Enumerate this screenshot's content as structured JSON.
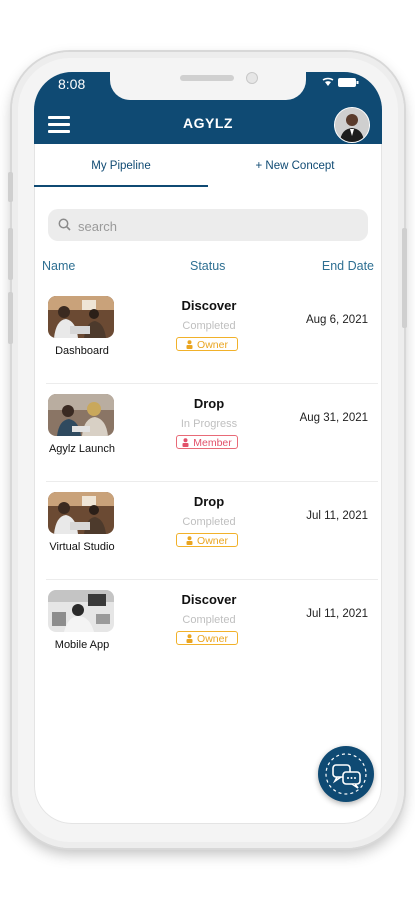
{
  "status_bar": {
    "time": "8:08",
    "icons": "wifi-icon battery-icon"
  },
  "app_bar": {
    "title": "AGYLZ"
  },
  "tabs": [
    {
      "label": "My Pipeline",
      "active": true
    },
    {
      "label": "+ New Concept",
      "active": false
    }
  ],
  "search": {
    "placeholder": "search",
    "value": ""
  },
  "columns": {
    "name": "Name",
    "status": "Status",
    "end_date": "End Date"
  },
  "rows": [
    {
      "name": "Dashboard",
      "stage": "Discover",
      "progress": "Completed",
      "role": "Owner",
      "end_date": "Aug 6, 2021"
    },
    {
      "name": "Agylz Launch",
      "stage": "Drop",
      "progress": "In Progress",
      "role": "Member",
      "end_date": "Aug 31, 2021"
    },
    {
      "name": "Virtual Studio",
      "stage": "Drop",
      "progress": "Completed",
      "role": "Owner",
      "end_date": "Jul 11, 2021"
    },
    {
      "name": "Mobile App",
      "stage": "Discover",
      "progress": "Completed",
      "role": "Owner",
      "end_date": "Jul 11, 2021"
    }
  ],
  "colors": {
    "primary": "#0f4a73",
    "owner": "#eaa520",
    "member": "#e2516a"
  },
  "fab": {
    "icon": "chat-bubbles-icon"
  }
}
